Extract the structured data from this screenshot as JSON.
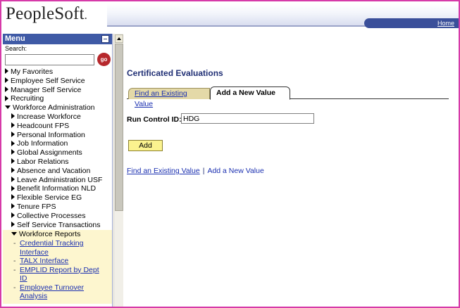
{
  "header": {
    "logo": "PeopleSoft",
    "logo_mark": ".",
    "home_link": "Home"
  },
  "menu": {
    "title": "Menu",
    "search_label": "Search:",
    "search_value": "",
    "go_label": "go",
    "items": [
      {
        "label": "My Favorites",
        "expanded": false,
        "level": 0
      },
      {
        "label": "Employee Self Service",
        "expanded": false,
        "level": 0
      },
      {
        "label": "Manager Self Service",
        "expanded": false,
        "level": 0
      },
      {
        "label": "Recruiting",
        "expanded": false,
        "level": 0
      },
      {
        "label": "Workforce Administration",
        "expanded": true,
        "level": 0
      },
      {
        "label": "Increase Workforce",
        "expanded": false,
        "level": 1
      },
      {
        "label": "Headcount FPS",
        "expanded": false,
        "level": 1
      },
      {
        "label": "Personal Information",
        "expanded": false,
        "level": 1
      },
      {
        "label": "Job Information",
        "expanded": false,
        "level": 1
      },
      {
        "label": "Global Assignments",
        "expanded": false,
        "level": 1
      },
      {
        "label": "Labor Relations",
        "expanded": false,
        "level": 1
      },
      {
        "label": "Absence and Vacation",
        "expanded": false,
        "level": 1
      },
      {
        "label": "Leave Administration USF",
        "expanded": false,
        "level": 1
      },
      {
        "label": "Benefit Information NLD",
        "expanded": false,
        "level": 1
      },
      {
        "label": "Flexible Service EG",
        "expanded": false,
        "level": 1
      },
      {
        "label": "Tenure FPS",
        "expanded": false,
        "level": 1
      },
      {
        "label": "Collective Processes",
        "expanded": false,
        "level": 1
      },
      {
        "label": "Self Service Transactions",
        "expanded": false,
        "level": 1
      }
    ],
    "reports": {
      "label": "Workforce Reports",
      "items": [
        {
          "line1": "Credential Tracking",
          "line2": "Interface"
        },
        {
          "line1": "TALX Interface",
          "line2": ""
        },
        {
          "line1": "EMPLID Report by Dept",
          "line2": "ID"
        },
        {
          "line1": "Employee Turnover",
          "line2": "Analysis"
        }
      ]
    }
  },
  "main": {
    "title": "Certificated Evaluations",
    "tabs": {
      "find": "Find an Existing Value",
      "add": "Add a New Value"
    },
    "run_control_label": "Run Control ID:",
    "run_control_value": "HDG",
    "add_button": "Add",
    "links": {
      "find": "Find an Existing Value",
      "separator": "|",
      "add": "Add a New Value"
    }
  },
  "colors": {
    "frame_border": "#d63aa8",
    "menu_header": "#3f5aa6",
    "title_color": "#1f2e74",
    "link": "#1a2fb0",
    "add_button": "#fbf38f",
    "reports_bg": "#fdf6cf",
    "go_button": "#b6282c"
  }
}
